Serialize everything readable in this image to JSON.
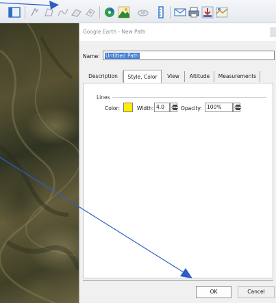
{
  "dialog": {
    "title": "Google Earth - New Path",
    "name_label": "Name:",
    "name_value": "Untitled Path",
    "tabs": [
      {
        "label": "Description",
        "active": false
      },
      {
        "label": "Style, Color",
        "active": true
      },
      {
        "label": "View",
        "active": false
      },
      {
        "label": "Altitude",
        "active": false
      },
      {
        "label": "Measurements",
        "active": false
      }
    ],
    "lines": {
      "group_label": "Lines",
      "color_label": "Color:",
      "color_value": "#ffee00",
      "width_label": "Width:",
      "width_value": "4.0",
      "opacity_label": "Opacity:",
      "opacity_value": "100%"
    },
    "ok_label": "OK",
    "cancel_label": "Cancel"
  },
  "toolbar": {
    "icons": [
      "sidebar-toggle-icon",
      "placemark-icon",
      "polygon-icon",
      "path-icon",
      "image-overlay-icon",
      "record-tour-icon",
      "historical-imagery-icon",
      "sunlight-icon",
      "planets-icon",
      "ruler-icon",
      "email-icon",
      "print-icon",
      "save-image-icon",
      "view-in-maps-icon"
    ]
  },
  "annotation": {
    "arrow_color": "#2d5ec6"
  }
}
